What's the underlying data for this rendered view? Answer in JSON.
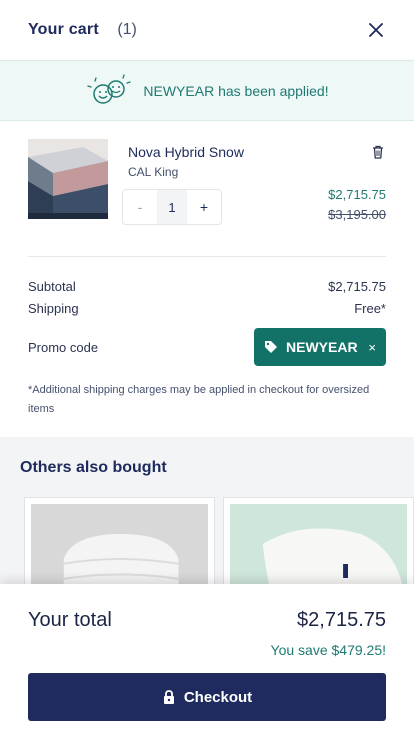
{
  "header": {
    "title": "Your cart",
    "count": "(1)",
    "close_icon": "close-icon"
  },
  "promo_banner": {
    "message": "NEWYEAR has been applied!",
    "icon": "happy-faces-icon"
  },
  "item": {
    "name": "Nova Hybrid Snow",
    "variant": "CAL King",
    "quantity": "1",
    "minus_label": "-",
    "plus_label": "+",
    "price": "$2,715.75",
    "original_price": "$3,195.00"
  },
  "summary": {
    "subtotal_label": "Subtotal",
    "subtotal_value": "$2,715.75",
    "shipping_label": "Shipping",
    "shipping_value": "Free*",
    "promo_label": "Promo code",
    "promo_code": "NEWYEAR",
    "promo_remove": "×",
    "note": "*Additional shipping charges may be applied in checkout for oversized items"
  },
  "others": {
    "heading": "Others also bought"
  },
  "footer": {
    "total_label": "Your total",
    "total_value": "$2,715.75",
    "savings": "You save $479.25!",
    "checkout_label": "Checkout"
  },
  "colors": {
    "accent": "#137268",
    "navy": "#1f2a5e",
    "banner_bg": "#eef8f7"
  }
}
